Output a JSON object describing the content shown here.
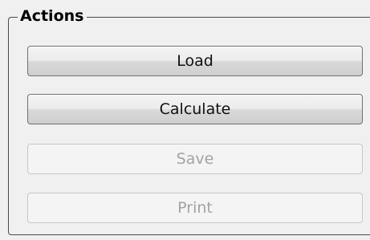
{
  "group": {
    "title": "Actions"
  },
  "buttons": {
    "load": {
      "label": "Load",
      "enabled": true
    },
    "calculate": {
      "label": "Calculate",
      "enabled": true
    },
    "save": {
      "label": "Save",
      "enabled": false
    },
    "print": {
      "label": "Print",
      "enabled": false
    }
  },
  "colors": {
    "background": "#f0f0f0",
    "enabled_text": "#111111",
    "disabled_text": "#a3a3a3",
    "group_border": "#4a4a4a"
  }
}
